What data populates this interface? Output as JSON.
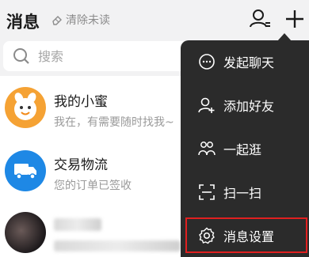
{
  "header": {
    "title": "消息",
    "clear_unread": "清除未读"
  },
  "search": {
    "placeholder": "搜索"
  },
  "conversations": [
    {
      "name": "我的小蜜",
      "preview": "我在，有需要随时找我~"
    },
    {
      "name": "交易物流",
      "preview": "您的订单已签收"
    },
    {
      "name": "",
      "preview": ""
    }
  ],
  "menu": {
    "items": [
      {
        "label": "发起聊天",
        "icon": "chat-bubble-icon"
      },
      {
        "label": "添加好友",
        "icon": "add-friend-icon"
      },
      {
        "label": "一起逛",
        "icon": "group-icon"
      },
      {
        "label": "扫一扫",
        "icon": "scan-icon"
      },
      {
        "label": "消息设置",
        "icon": "gear-icon"
      }
    ],
    "highlighted_item": "消息设置"
  },
  "colors": {
    "header_bg": "#f2f2f3",
    "menu_bg": "#2b2b2b",
    "highlight_border": "#e02020",
    "assistant_avatar": "#f5a234",
    "logistics_avatar": "#1e88e5"
  }
}
